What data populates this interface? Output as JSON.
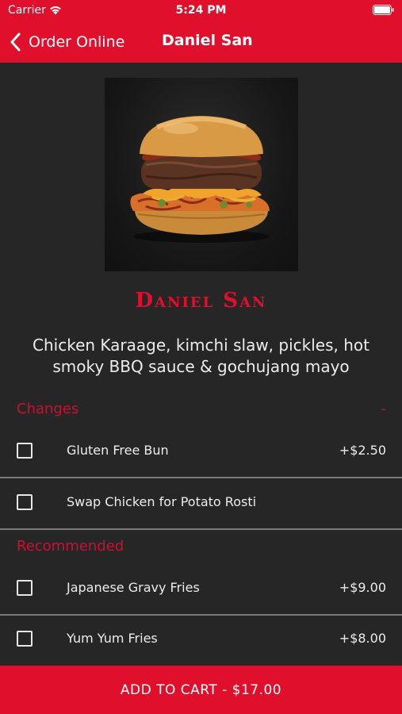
{
  "status_bar": {
    "carrier": "Carrier",
    "time": "5:24 PM"
  },
  "nav": {
    "back_label": "Order Online",
    "title": "Daniel San"
  },
  "item": {
    "title": "Daniel San",
    "description": "Chicken Karaage, kimchi slaw, pickles, hot smoky BBQ sauce & gochujang mayo"
  },
  "sections": {
    "changes": {
      "title": "Changes",
      "collapse": "-",
      "options": [
        {
          "label": "Gluten Free Bun",
          "price": "+$2.50",
          "checked": false
        },
        {
          "label": "Swap Chicken for Potato Rosti",
          "price": "",
          "checked": false
        }
      ]
    },
    "recommended": {
      "title": "Recommended",
      "options": [
        {
          "label": "Japanese Gravy Fries",
          "price": "+$9.00",
          "checked": false
        },
        {
          "label": "Yum Yum Fries",
          "price": "+$8.00",
          "checked": false
        }
      ]
    }
  },
  "cart": {
    "label": "ADD TO CART - $17.00"
  },
  "colors": {
    "accent": "#e0102d",
    "background": "#262626",
    "divider": "#7a7a7a"
  },
  "icons": {
    "back": "chevron-left-icon",
    "wifi": "wifi-icon",
    "battery": "battery-icon"
  }
}
